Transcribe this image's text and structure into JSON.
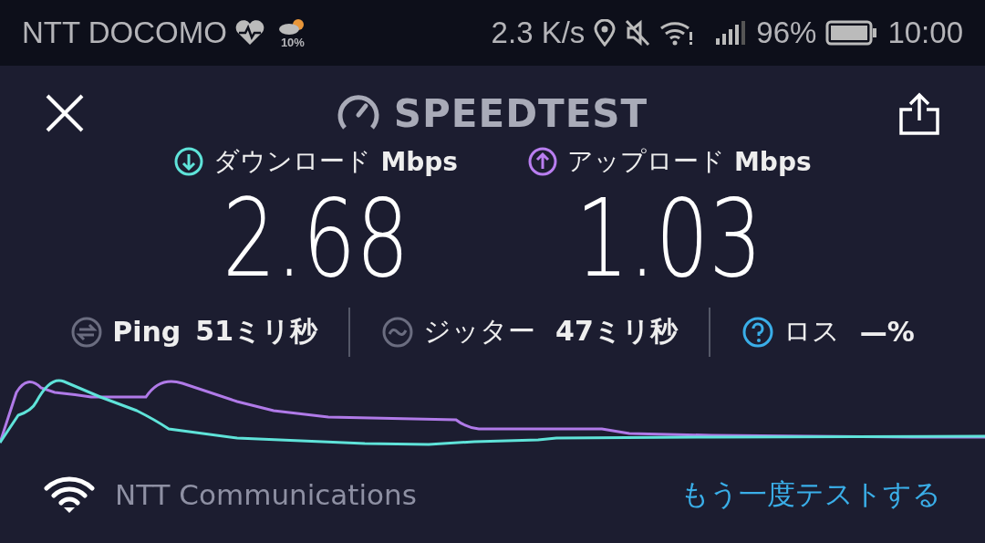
{
  "status_bar": {
    "carrier": "NTT DOCOMO",
    "weather_percent": "10%",
    "speed": "2.3 K/s",
    "battery": "96%",
    "time": "10:00"
  },
  "header": {
    "title": "SPEEDTEST"
  },
  "results": [
    {
      "kind": "download",
      "label": "ダウンロード",
      "unit": "Mbps",
      "value": "2.68"
    },
    {
      "kind": "upload",
      "label": "アップロード",
      "unit": "Mbps",
      "value": "1.03"
    }
  ],
  "metrics": [
    {
      "kind": "ping",
      "label": "Ping",
      "value": "51ミリ秒"
    },
    {
      "kind": "jitter",
      "label": "ジッター",
      "value": "47ミリ秒"
    },
    {
      "kind": "loss",
      "label": "ロス",
      "value": "—%"
    }
  ],
  "footer": {
    "provider": "NTT Communications",
    "retest": "もう一度テストする"
  }
}
